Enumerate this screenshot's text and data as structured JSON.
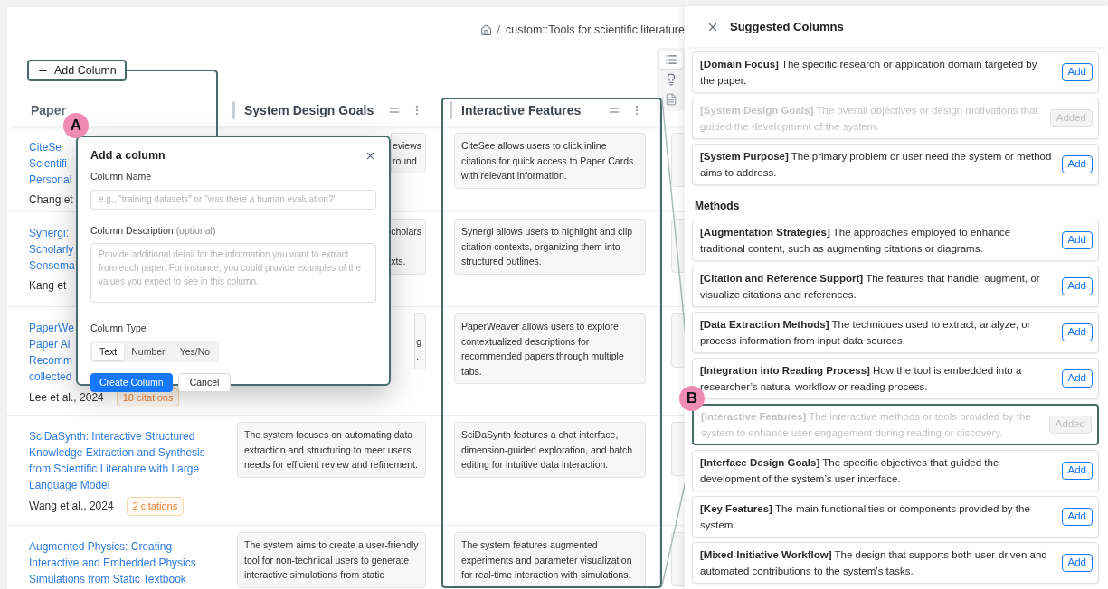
{
  "breadcrumb": {
    "separator": "/",
    "path": "custom::Tools for scientific literature"
  },
  "toolbar": {
    "add_button": "Add Column",
    "highlighted": true
  },
  "icon_strip": [
    {
      "kind": "list",
      "selected": true
    },
    {
      "kind": "bulb",
      "selected": false
    },
    {
      "kind": "pdf",
      "selected": false
    }
  ],
  "table": {
    "columns": [
      {
        "label": "Paper",
        "kind": "paper"
      },
      {
        "label": "System Design Goals",
        "kind": "field"
      },
      {
        "label": "Interactive Features",
        "kind": "field",
        "highlighted": true
      },
      {
        "kind": "cut"
      }
    ],
    "rows": [
      {
        "title": "CiteSe\nScientifi\nPersonal",
        "meta": "Chang et",
        "cells": [
          {
            "text": "eviews\nround",
            "partial": true
          },
          {
            "text": "CiteSee allows users to click inline citations for quick access to Paper Cards with relevant information.",
            "partial": false
          }
        ]
      },
      {
        "title": "Synergi:\nScholarly\nSensema",
        "meta": "Kang et",
        "cells": [
          {
            "text": "cholars\n\nxts.",
            "partial": true
          },
          {
            "text": "Synergi allows users to highlight and clip citation contexts, organizing them into structured outlines.",
            "partial": false
          }
        ]
      },
      {
        "title": "PaperWe\nPaper Al\nRecomm\ncollected",
        "meta": "Lee et al., 2024",
        "citations": "18 citations",
        "cells": [
          {
            "text": "\ng\n.",
            "partial": true
          },
          {
            "text": "PaperWeaver allows users to explore contextualized descriptions for recommended papers through multiple tabs.",
            "partial": false
          }
        ]
      },
      {
        "title": "SciDaSynth: Interactive Structured Knowledge Extraction and Synthesis from Scientific Literature with Large Language Model",
        "meta": "Wang et al., 2024",
        "citations": "2 citations",
        "cells": [
          {
            "text": "The system focuses on automating data extraction and structuring to meet users' needs for efficient review and refinement.",
            "partial": false
          },
          {
            "text": "SciDaSynth features a chat interface, dimension-guided exploration, and batch editing for intuitive data interaction.",
            "partial": false
          }
        ]
      },
      {
        "title": "Augmented Physics: Creating Interactive and Embedded Physics Simulations from Static Textbook",
        "cells": [
          {
            "text": "The system aims to create a user-friendly tool for non-technical users to generate interactive simulations from static",
            "partial": false
          },
          {
            "text": "The system features augmented experiments and parameter visualization for real-time interaction with simulations.",
            "partial": false
          }
        ]
      }
    ]
  },
  "dialog": {
    "badge": "A",
    "title": "Add a column",
    "name_label": "Column Name",
    "name_placeholder": "e.g., \"training datasets\" or \"was there a human evaluation?\"",
    "desc_label": "Column Description",
    "desc_optional": "(optional)",
    "desc_placeholder": "Provide additional detail for the information you want to extract from each paper. For instance, you could provide examples of the values you expect to see in this column.",
    "type_label": "Column Type",
    "types": [
      {
        "label": "Text",
        "selected": true
      },
      {
        "label": "Number",
        "selected": false
      },
      {
        "label": "Yes/No",
        "selected": false
      }
    ],
    "buttons": [
      {
        "label": "Create Column",
        "kind": "primary"
      },
      {
        "label": "Cancel",
        "kind": "secondary"
      }
    ]
  },
  "panel": {
    "title": "Suggested Columns",
    "sections": [
      {
        "items": [
          {
            "name": "[Domain Focus]",
            "description": "The specific research or application domain targeted by the paper.",
            "action": "Add",
            "added": false,
            "highlighted": false
          },
          {
            "name": "[System Design Goals]",
            "description": "The overall objectives or design motivations that guided the development of the system.",
            "action": "Added",
            "added": true,
            "highlighted": false
          },
          {
            "name": "[System Purpose]",
            "description": "The primary problem or user need the system or method aims to address.",
            "action": "Add",
            "added": false,
            "highlighted": false
          }
        ]
      },
      {
        "heading": "Methods",
        "items": [
          {
            "name": "[Augmentation Strategies]",
            "description": "The approaches employed to enhance traditional content, such as augmenting citations or diagrams.",
            "action": "Add",
            "added": false,
            "highlighted": false
          },
          {
            "name": "[Citation and Reference Support]",
            "description": "The features that handle, augment, or visualize citations and references.",
            "action": "Add",
            "added": false,
            "highlighted": false
          },
          {
            "name": "[Data Extraction Methods]",
            "description": "The techniques used to extract, analyze, or process information from input data sources.",
            "action": "Add",
            "added": false,
            "highlighted": false
          },
          {
            "name": "[Integration into Reading Process]",
            "description": "How the tool is embedded into a researcher’s natural workflow or reading process.",
            "action": "Add",
            "added": false,
            "highlighted": false
          },
          {
            "name": "[Interactive Features]",
            "description": "The interactive methods or tools provided by the system to enhance user engagement during reading or discovery.",
            "action": "Added",
            "added": true,
            "highlighted": true,
            "badge": "B"
          },
          {
            "name": "[Interface Design Goals]",
            "description": "The specific objectives that guided the development of the system’s user interface.",
            "action": "Add",
            "added": false,
            "highlighted": false
          },
          {
            "name": "[Key Features]",
            "description": "The main functionalities or components provided by the system.",
            "action": "Add",
            "added": false,
            "highlighted": false
          },
          {
            "name": "[Mixed-Initiative Workflow]",
            "description": "The design that supports both user-driven and automated contributions to the system’s tasks.",
            "action": "Add",
            "added": false,
            "highlighted": false
          }
        ]
      }
    ]
  }
}
